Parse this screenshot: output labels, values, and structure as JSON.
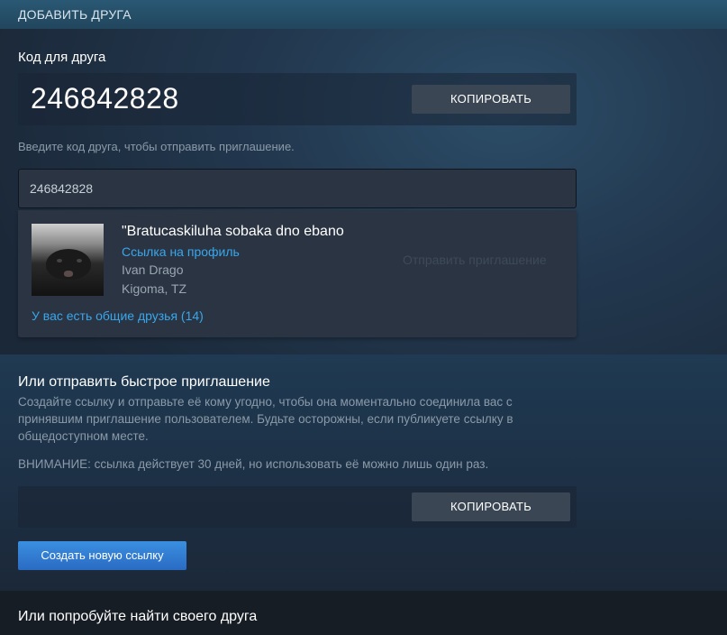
{
  "header": {
    "title": "ДОБАВИТЬ ДРУГА"
  },
  "friend_code": {
    "heading": "Код для друга",
    "value": "246842828",
    "copy_label": "КОПИРОВАТЬ"
  },
  "invite": {
    "hint": "Введите код друга, чтобы отправить приглашение.",
    "input_value": "246842828"
  },
  "result": {
    "name": "\"Bratucaskiluha sobaka dno ebano",
    "profile_link": "Ссылка на профиль",
    "real_name": "Ivan Drago",
    "location": "Kigoma, TZ",
    "send_invite": "Отправить приглашение",
    "mutual_friends": "У вас есть общие друзья (14)"
  },
  "quick_invite": {
    "title": "Или отправить быстрое приглашение",
    "description": "Создайте ссылку и отправьте её кому угодно, чтобы она моментально соединила вас с принявшим приглашение пользователем. Будьте осторожны, если публикуете ссылку в общедоступном месте.",
    "warning": "ВНИМАНИЕ: ссылка действует 30 дней, но использовать её можно лишь один раз.",
    "copy_label": "КОПИРОВАТЬ",
    "new_link_label": "Создать новую ссылку"
  },
  "find_friend": {
    "title": "Или попробуйте найти своего друга"
  }
}
